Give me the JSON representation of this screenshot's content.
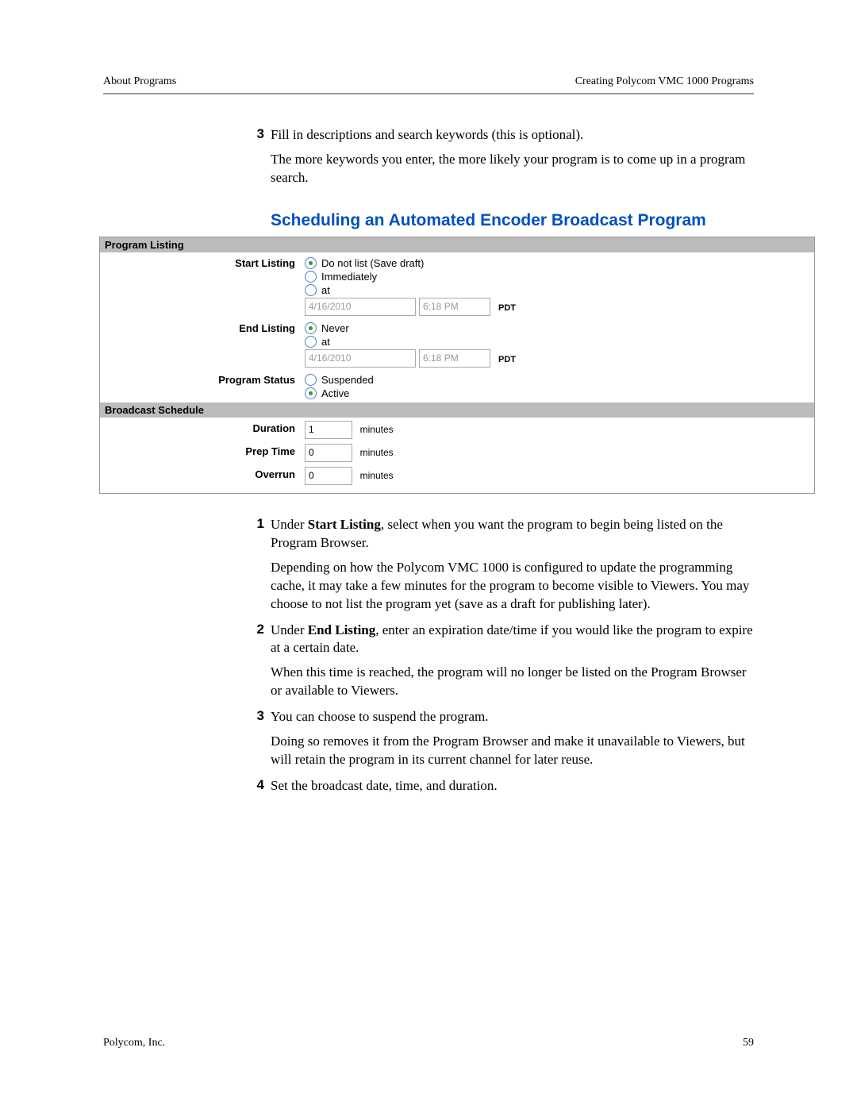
{
  "header": {
    "left": "About Programs",
    "right": "Creating Polycom VMC 1000 Programs"
  },
  "intro": {
    "step3_num": "3",
    "step3_text": "Fill in descriptions and search keywords (this is optional).",
    "step3_para": "The more keywords you enter, the more likely your program is to come up in a program search."
  },
  "section_title": "Scheduling an Automated Encoder Broadcast Program",
  "form": {
    "program_listing_header": "Program Listing",
    "start_listing": {
      "label": "Start Listing",
      "opt_no_list": "Do not list (Save draft)",
      "opt_immediately": "Immediately",
      "opt_at": "at",
      "date": "4/16/2010",
      "time": "6:18 PM",
      "tz": "PDT"
    },
    "end_listing": {
      "label": "End Listing",
      "opt_never": "Never",
      "opt_at": "at",
      "date": "4/16/2010",
      "time": "6:18 PM",
      "tz": "PDT"
    },
    "program_status": {
      "label": "Program Status",
      "opt_suspended": "Suspended",
      "opt_active": "Active"
    },
    "broadcast_schedule_header": "Broadcast Schedule",
    "duration": {
      "label": "Duration",
      "value": "1",
      "unit": "minutes"
    },
    "prep_time": {
      "label": "Prep Time",
      "value": "0",
      "unit": "minutes"
    },
    "overrun": {
      "label": "Overrun",
      "value": "0",
      "unit": "minutes"
    }
  },
  "steps": {
    "s1_num": "1",
    "s1_text_a": "Under ",
    "s1_bold": "Start Listing",
    "s1_text_b": ", select when you want the program to begin being listed on the Program Browser.",
    "s1_para": "Depending on how the Polycom VMC 1000 is configured to update the programming cache, it may take a few minutes for the program to become visible to Viewers. You may choose to not list the program yet (save as a draft for publishing later).",
    "s2_num": "2",
    "s2_text_a": "Under ",
    "s2_bold": "End Listing",
    "s2_text_b": ", enter an expiration date/time if you would like the program to expire at a certain date.",
    "s2_para": "When this time is reached, the program will no longer be listed on the Program Browser or available to Viewers.",
    "s3_num": "3",
    "s3_text": "You can choose to suspend the program.",
    "s3_para": "Doing so removes it from the Program Browser and make it unavailable to Viewers, but will retain the program in its current channel for later reuse.",
    "s4_num": "4",
    "s4_text": "Set the broadcast date, time, and duration."
  },
  "footer": {
    "left": "Polycom, Inc.",
    "right": "59"
  }
}
